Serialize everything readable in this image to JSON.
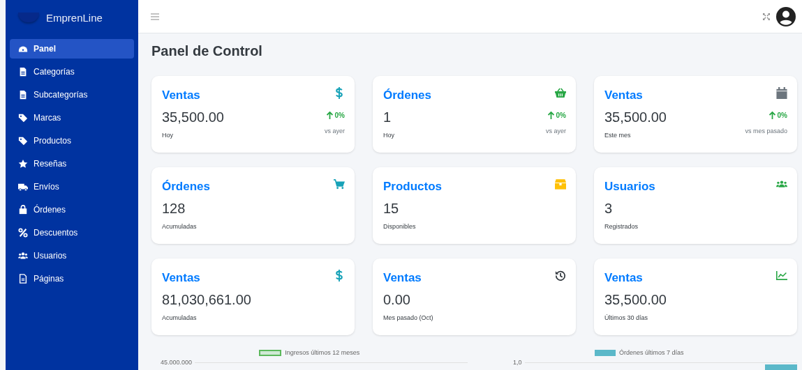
{
  "sidebar": {
    "brand": "EmprenLine",
    "items": [
      {
        "label": "Panel",
        "selected": true
      },
      {
        "label": "Categorías",
        "selected": false
      },
      {
        "label": "Subcategorías",
        "selected": false
      },
      {
        "label": "Marcas",
        "selected": false
      },
      {
        "label": "Productos",
        "selected": false
      },
      {
        "label": "Reseñas",
        "selected": false
      },
      {
        "label": "Envíos",
        "selected": false
      },
      {
        "label": "Órdenes",
        "selected": false
      },
      {
        "label": "Descuentos",
        "selected": false
      },
      {
        "label": "Usuarios",
        "selected": false
      },
      {
        "label": "Páginas",
        "selected": false
      }
    ]
  },
  "page_title": "Panel de Control",
  "cards": [
    {
      "title": "Ventas",
      "value": "35,500.00",
      "caption": "Hoy",
      "trend": "0%",
      "trend_caption": "vs ayer"
    },
    {
      "title": "Órdenes",
      "value": "1",
      "caption": "Hoy",
      "trend": "0%",
      "trend_caption": "vs ayer"
    },
    {
      "title": "Ventas",
      "value": "35,500.00",
      "caption": "Este mes",
      "trend": "0%",
      "trend_caption": "vs mes pasado"
    },
    {
      "title": "Órdenes",
      "value": "128",
      "caption": "Acumuladas"
    },
    {
      "title": "Productos",
      "value": "15",
      "caption": "Disponibles"
    },
    {
      "title": "Usuarios",
      "value": "3",
      "caption": "Registrados"
    },
    {
      "title": "Ventas",
      "value": "81,030,661.00",
      "caption": "Acumuladas"
    },
    {
      "title": "Ventas",
      "value": "0.00",
      "caption": "Mes pasado (Oct)"
    },
    {
      "title": "Ventas",
      "value": "35,500.00",
      "caption": "Últimos 30 días"
    }
  ],
  "charts": [
    {
      "legend": "Ingresos últimos 12 meses",
      "top_tick": "45.000.000"
    },
    {
      "legend": "Órdenes últimos 7 días",
      "top_tick": "1,0"
    }
  ]
}
